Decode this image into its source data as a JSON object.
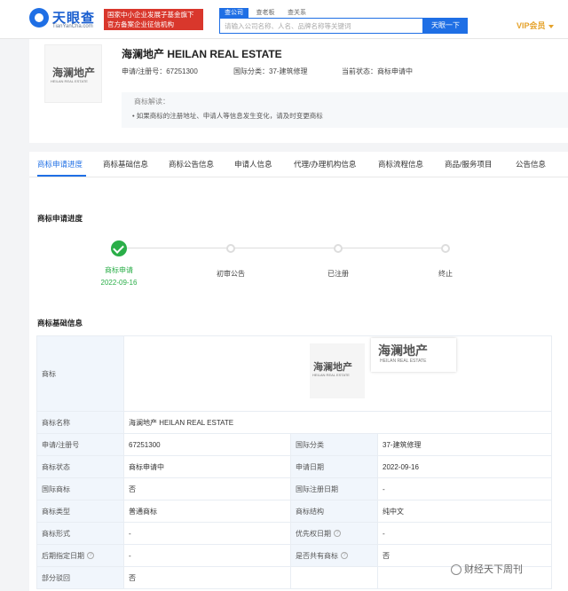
{
  "header": {
    "logo_name": "天眼查",
    "logo_url": "TianYanCha.com",
    "badge_line1": "国家中小企业发展子基金旗下",
    "badge_line2": "官方备案企业征信机构",
    "search_tabs": [
      "查公司",
      "查老板",
      "查关系"
    ],
    "search_placeholder": "请输入公司名称、人名、品牌名称等关键词",
    "search_button": "天眼一下",
    "vip_label": "VIP会员"
  },
  "summary": {
    "title": "海澜地产 HEILAN REAL ESTATE",
    "reg_no": "申请/注册号：67251300",
    "intl_class": "国际分类：37-建筑修理",
    "status": "当前状态：商标申请中",
    "interp_title": "商标解读：",
    "interp_line": "• 如果商标的注册地址、申请人等信息发生变化，请及时变更商标",
    "logo_cn": "海澜地产",
    "logo_en": "HEILAN REAL ESTATE"
  },
  "tabs": [
    "商标申请进度",
    "商标基础信息",
    "商标公告信息",
    "申请人信息",
    "代理/办理机构信息",
    "商标流程信息",
    "商品/服务项目",
    "公告信息"
  ],
  "progress": {
    "title": "商标申请进度",
    "steps": [
      {
        "label": "商标申请",
        "date": "2022-09-16"
      },
      {
        "label": "初审公告"
      },
      {
        "label": "已注册"
      },
      {
        "label": "终止"
      }
    ]
  },
  "basic": {
    "title": "商标基础信息",
    "logo_label": "商标",
    "name_label": "商标名称",
    "name_value": "海澜地产 HEILAN REAL ESTATE",
    "rows": [
      {
        "l1": "申请/注册号",
        "v1": "67251300",
        "l2": "国际分类",
        "v2": "37-建筑修理"
      },
      {
        "l1": "商标状态",
        "v1": "商标申请中",
        "l2": "申请日期",
        "v2": "2022-09-16"
      },
      {
        "l1": "国际商标",
        "v1": "否",
        "l2": "国际注册日期",
        "v2": "-"
      },
      {
        "l1": "商标类型",
        "v1": "普通商标",
        "l2": "商标结构",
        "v2": "纯中文"
      },
      {
        "l1": "商标形式",
        "v1": "-",
        "l2": "优先权日期",
        "v2": "-"
      },
      {
        "l1": "后期指定日期",
        "v1": "-",
        "l2": "是否共有商标",
        "v2": "否"
      }
    ],
    "last_label": "部分驳回",
    "last_value": "否"
  },
  "watermark": "财经天下周刊"
}
